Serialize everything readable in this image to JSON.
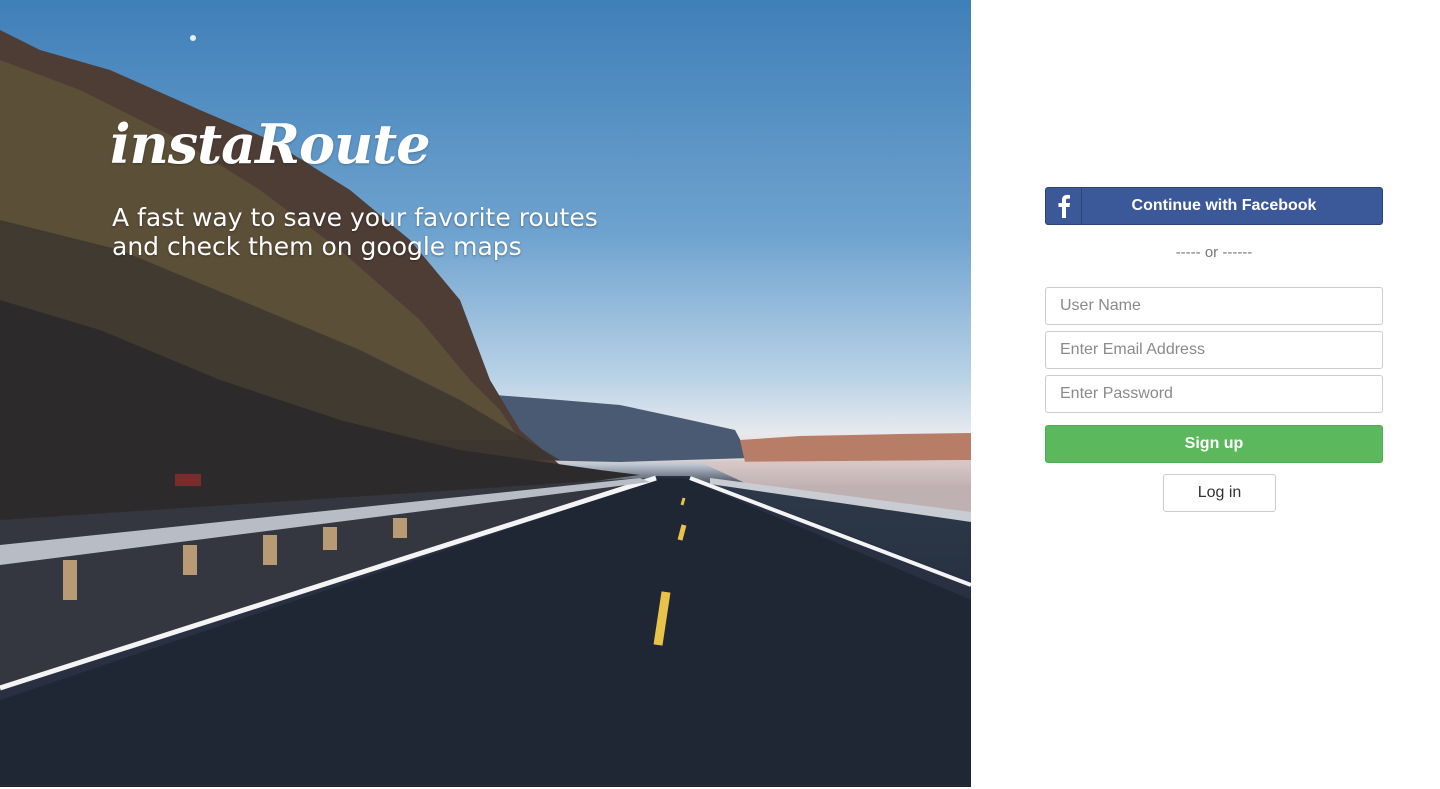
{
  "hero": {
    "logo_text": "instaRoute",
    "tagline_line1": "A fast way to save your favorite routes",
    "tagline_line2": "and check them on google maps"
  },
  "auth": {
    "facebook_icon": "facebook-icon",
    "facebook_label": "Continue with Facebook",
    "divider_text": "----- or ------",
    "username_placeholder": "User Name",
    "email_placeholder": "Enter Email Address",
    "password_placeholder": "Enter Password",
    "signup_label": "Sign up",
    "login_label": "Log in"
  },
  "colors": {
    "facebook_blue": "#3b5998",
    "signup_green": "#5cb85c"
  }
}
